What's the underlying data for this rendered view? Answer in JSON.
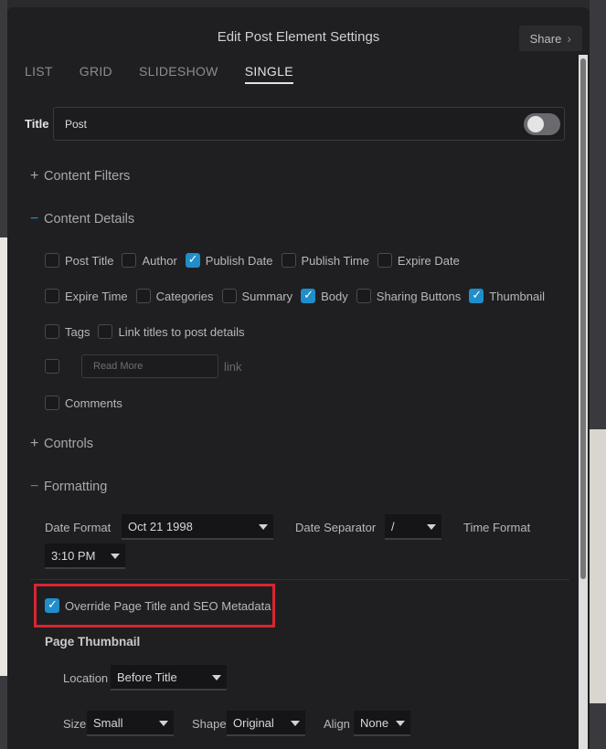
{
  "modal": {
    "title": "Edit Post Element Settings",
    "share_label": "Share"
  },
  "tabs": [
    "LIST",
    "GRID",
    "SLIDESHOW",
    "SINGLE"
  ],
  "active_tab": "SINGLE",
  "title_field": {
    "label": "Title",
    "value": "Post",
    "toggle_on": false
  },
  "sections": {
    "content_filters": {
      "label": "Content Filters",
      "expanded": false
    },
    "content_details": {
      "label": "Content Details",
      "expanded": true
    },
    "controls": {
      "label": "Controls",
      "expanded": false
    },
    "formatting": {
      "label": "Formatting",
      "expanded": true
    }
  },
  "content_details": {
    "row1": [
      {
        "label": "Post Title",
        "checked": false
      },
      {
        "label": "Author",
        "checked": false
      },
      {
        "label": "Publish Date",
        "checked": true
      },
      {
        "label": "Publish Time",
        "checked": false
      },
      {
        "label": "Expire Date",
        "checked": false
      }
    ],
    "row2": [
      {
        "label": "Expire Time",
        "checked": false
      },
      {
        "label": "Categories",
        "checked": false
      },
      {
        "label": "Summary",
        "checked": false
      },
      {
        "label": "Body",
        "checked": true
      },
      {
        "label": "Sharing Buttons",
        "checked": false
      },
      {
        "label": "Thumbnail",
        "checked": true
      }
    ],
    "row3": [
      {
        "label": "Tags",
        "checked": false
      },
      {
        "label": "Link titles to post details",
        "checked": false
      }
    ],
    "read_more": {
      "checked": false,
      "placeholder": "Read More",
      "suffix": "link"
    },
    "comments": {
      "label": "Comments",
      "checked": false
    }
  },
  "formatting": {
    "date_format_label": "Date Format",
    "date_format_value": "Oct 21 1998",
    "date_separator_label": "Date Separator",
    "date_separator_value": "/",
    "time_format_label": "Time Format",
    "time_format_value": "3:10 PM",
    "override_label": "Override Page Title and SEO Metadata",
    "override_checked": true
  },
  "page_thumbnail": {
    "heading": "Page Thumbnail",
    "location_label": "Location",
    "location_value": "Before Title",
    "size_label": "Size",
    "size_value": "Small",
    "shape_label": "Shape",
    "shape_value": "Original",
    "align_label": "Align",
    "align_value": "None"
  }
}
